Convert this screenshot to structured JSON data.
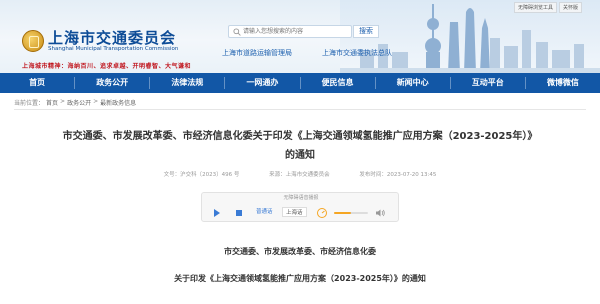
{
  "header": {
    "title": "上海市交通委员会",
    "subtitle": "Shanghai Municipal Transportation Commission",
    "slogan": "上海城市精神：海纳百川、追求卓越、开明睿智、大气谦和",
    "search_placeholder": "请输入您想搜索的内容",
    "search_button": "搜索",
    "quick_links": [
      "上海市道路运输管理局",
      "上海市交通委执法总队"
    ],
    "top_links": [
      "无障碍浏览工具",
      "关怀版"
    ]
  },
  "nav": {
    "items": [
      "首页",
      "政务公开",
      "法律法规",
      "一网通办",
      "便民信息",
      "新闻中心",
      "互动平台",
      "微博微信"
    ]
  },
  "breadcrumb": {
    "prefix": "当前位置：",
    "items": [
      "首页",
      "政务公开",
      "最新政务信息"
    ],
    "separator": ">"
  },
  "article": {
    "title_line1": "市交通委、市发展改革委、市经济信息化委关于印发《上海交通领域氢能推广应用方案（2023-2025年）》",
    "title_line2": "的通知",
    "doc_number": "文号：沪交科〔2023〕496 号",
    "source": "来源：上海市交通委员会",
    "date": "发布时间：2023-07-20 13:45",
    "issuers": "市交通委、市发展改革委、市经济信息化委",
    "notice": "关于印发《上海交通领域氢能推广应用方案（2023-2025年）》的通知"
  },
  "player": {
    "caption": "无障碍语音播报",
    "voice_label": "普通话",
    "dialect_label": "上海话",
    "volume": 0.5
  },
  "colors": {
    "brand_blue": "#1257a6",
    "title_blue": "#0d4c97",
    "slogan_red": "#c0141c",
    "volume_orange": "#f5a623"
  }
}
